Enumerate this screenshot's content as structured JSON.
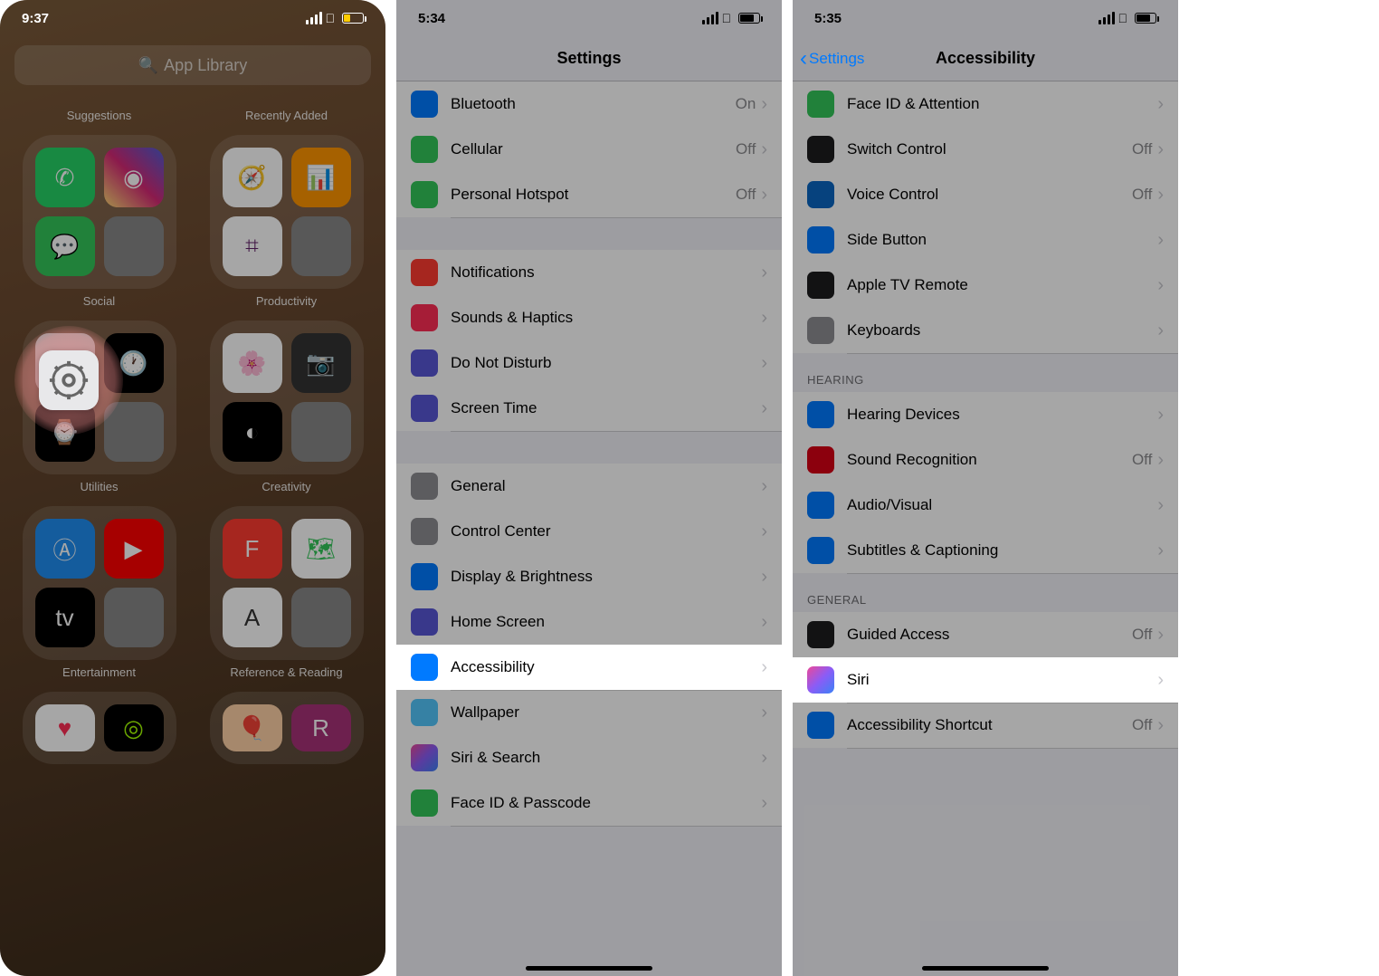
{
  "panel1": {
    "time": "9:37",
    "search_placeholder": "App Library",
    "row_labels": {
      "r0c0": "Suggestions",
      "r0c1": "Recently Added"
    },
    "folders": [
      {
        "label": "Social"
      },
      {
        "label": "Productivity"
      },
      {
        "label": "Utilities"
      },
      {
        "label": "Creativity"
      },
      {
        "label": "Entertainment"
      },
      {
        "label": "Reference & Reading"
      }
    ]
  },
  "panel2": {
    "time": "5:34",
    "title": "Settings",
    "rows": [
      {
        "icon": "c-bt",
        "label": "Bluetooth",
        "value": "On"
      },
      {
        "icon": "c-cell",
        "label": "Cellular",
        "value": "Off"
      },
      {
        "icon": "c-hotspot",
        "label": "Personal Hotspot",
        "value": "Off"
      }
    ],
    "rows2": [
      {
        "icon": "c-notif",
        "label": "Notifications"
      },
      {
        "icon": "c-sounds",
        "label": "Sounds & Haptics"
      },
      {
        "icon": "c-dnd",
        "label": "Do Not Disturb"
      },
      {
        "icon": "c-screentime",
        "label": "Screen Time"
      }
    ],
    "rows3": [
      {
        "icon": "c-general",
        "label": "General"
      },
      {
        "icon": "c-cc",
        "label": "Control Center"
      },
      {
        "icon": "c-disp",
        "label": "Display & Brightness"
      },
      {
        "icon": "c-home",
        "label": "Home Screen"
      },
      {
        "icon": "c-access",
        "label": "Accessibility",
        "hl": true
      },
      {
        "icon": "c-wall",
        "label": "Wallpaper"
      },
      {
        "icon": "c-siri",
        "label": "Siri & Search"
      },
      {
        "icon": "c-faceid",
        "label": "Face ID & Passcode"
      }
    ]
  },
  "panel3": {
    "time": "5:35",
    "back": "Settings",
    "title": "Accessibility",
    "rows1": [
      {
        "icon": "c-faceatt",
        "label": "Face ID & Attention"
      },
      {
        "icon": "c-switch",
        "label": "Switch Control",
        "value": "Off"
      },
      {
        "icon": "c-voice",
        "label": "Voice Control",
        "value": "Off"
      },
      {
        "icon": "c-side",
        "label": "Side Button"
      },
      {
        "icon": "c-remote",
        "label": "Apple TV Remote"
      },
      {
        "icon": "c-kb",
        "label": "Keyboards"
      }
    ],
    "sec2": "HEARING",
    "rows2": [
      {
        "icon": "c-hearing",
        "label": "Hearing Devices"
      },
      {
        "icon": "c-sound-rec",
        "label": "Sound Recognition",
        "value": "Off"
      },
      {
        "icon": "c-audio",
        "label": "Audio/Visual"
      },
      {
        "icon": "c-subs",
        "label": "Subtitles & Captioning"
      }
    ],
    "sec3": "GENERAL",
    "rows3": [
      {
        "icon": "c-guided",
        "label": "Guided Access",
        "value": "Off"
      },
      {
        "icon": "c-siri",
        "label": "Siri",
        "hl": true
      },
      {
        "icon": "c-short",
        "label": "Accessibility Shortcut",
        "value": "Off"
      }
    ]
  }
}
